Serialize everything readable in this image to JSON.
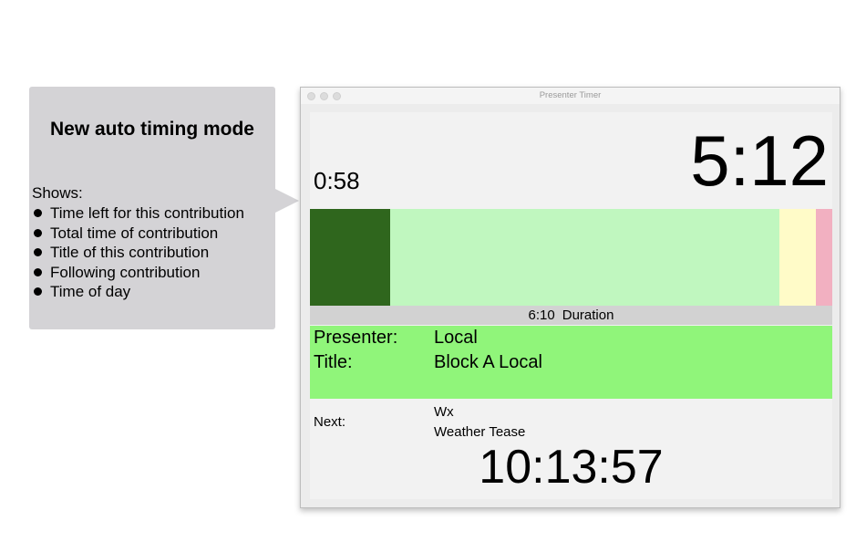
{
  "callout": {
    "title": "New auto timing mode",
    "shows_label": "Shows:",
    "items": [
      "Time left for this contribution",
      "Total time of contribution",
      "Title of this contribution",
      "Following contribution",
      "Time of day"
    ]
  },
  "window": {
    "title": "Presenter Timer"
  },
  "timer": {
    "time_left": "0:58",
    "total_time": "5:12",
    "duration_value": "6:10",
    "duration_label": "Duration",
    "progress": {
      "elapsed_fraction": 0.154,
      "remaining_fraction": 0.745,
      "warning_fraction": 0.07,
      "overtime_fraction": 0.031
    },
    "colors": {
      "elapsed": "#2f661d",
      "remaining": "#c0f7bf",
      "warning": "#fffbc8",
      "overtime": "#f2b0c1",
      "current_panel": "#90f57a"
    }
  },
  "current": {
    "presenter_label": "Presenter:",
    "presenter_value": "Local",
    "title_label": "Title:",
    "title_value": "Block A Local"
  },
  "next": {
    "label": "Next:",
    "presenter": "Wx",
    "title": "Weather Tease"
  },
  "clock": "10:13:57"
}
